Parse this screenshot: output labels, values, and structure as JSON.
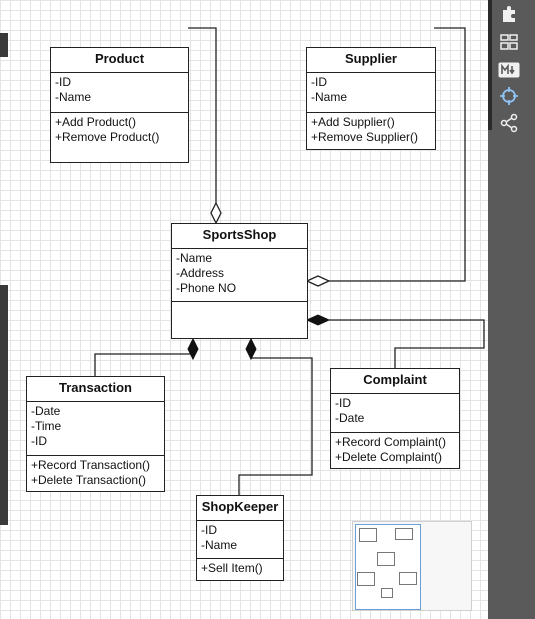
{
  "diagram": {
    "classes": [
      {
        "name": "Product",
        "attributes": [
          "-ID",
          "-Name"
        ],
        "operations": [
          "+Add Product()",
          "+Remove Product()"
        ]
      },
      {
        "name": "Supplier",
        "attributes": [
          "-ID",
          "-Name"
        ],
        "operations": [
          "+Add Supplier()",
          "+Remove Supplier()"
        ]
      },
      {
        "name": "SportsShop",
        "attributes": [
          "-Name",
          "-Address",
          "-Phone NO"
        ],
        "operations": []
      },
      {
        "name": "Transaction",
        "attributes": [
          "-Date",
          "-Time",
          "-ID"
        ],
        "operations": [
          "+Record Transaction()",
          "+Delete Transaction()"
        ]
      },
      {
        "name": "Complaint",
        "attributes": [
          "-ID",
          "-Date"
        ],
        "operations": [
          "+Record Complaint()",
          "+Delete Complaint()"
        ]
      },
      {
        "name": "ShopKeeper",
        "attributes": [
          "-ID",
          "-Name"
        ],
        "operations": [
          "+Sell Item()"
        ]
      }
    ],
    "relations": [
      {
        "from": "Product",
        "to": "SportsShop",
        "kind": "aggregation"
      },
      {
        "from": "Supplier",
        "to": "SportsShop",
        "kind": "aggregation"
      },
      {
        "from": "Transaction",
        "to": "SportsShop",
        "kind": "composition"
      },
      {
        "from": "ShopKeeper",
        "to": "SportsShop",
        "kind": "composition"
      },
      {
        "from": "Complaint",
        "to": "SportsShop",
        "kind": "composition"
      }
    ]
  },
  "toolbar": {
    "tools": [
      {
        "icon": "puzzle-icon"
      },
      {
        "icon": "layout-icon"
      },
      {
        "icon": "markdown-icon"
      },
      {
        "icon": "crosshair-icon"
      },
      {
        "icon": "share-icon"
      }
    ]
  },
  "colors": {
    "canvas": "#ffffff",
    "grid": "#e4e4e4",
    "line": "#222222",
    "sidebar": "#5a5a5a",
    "accent": "#6aa0d8"
  }
}
